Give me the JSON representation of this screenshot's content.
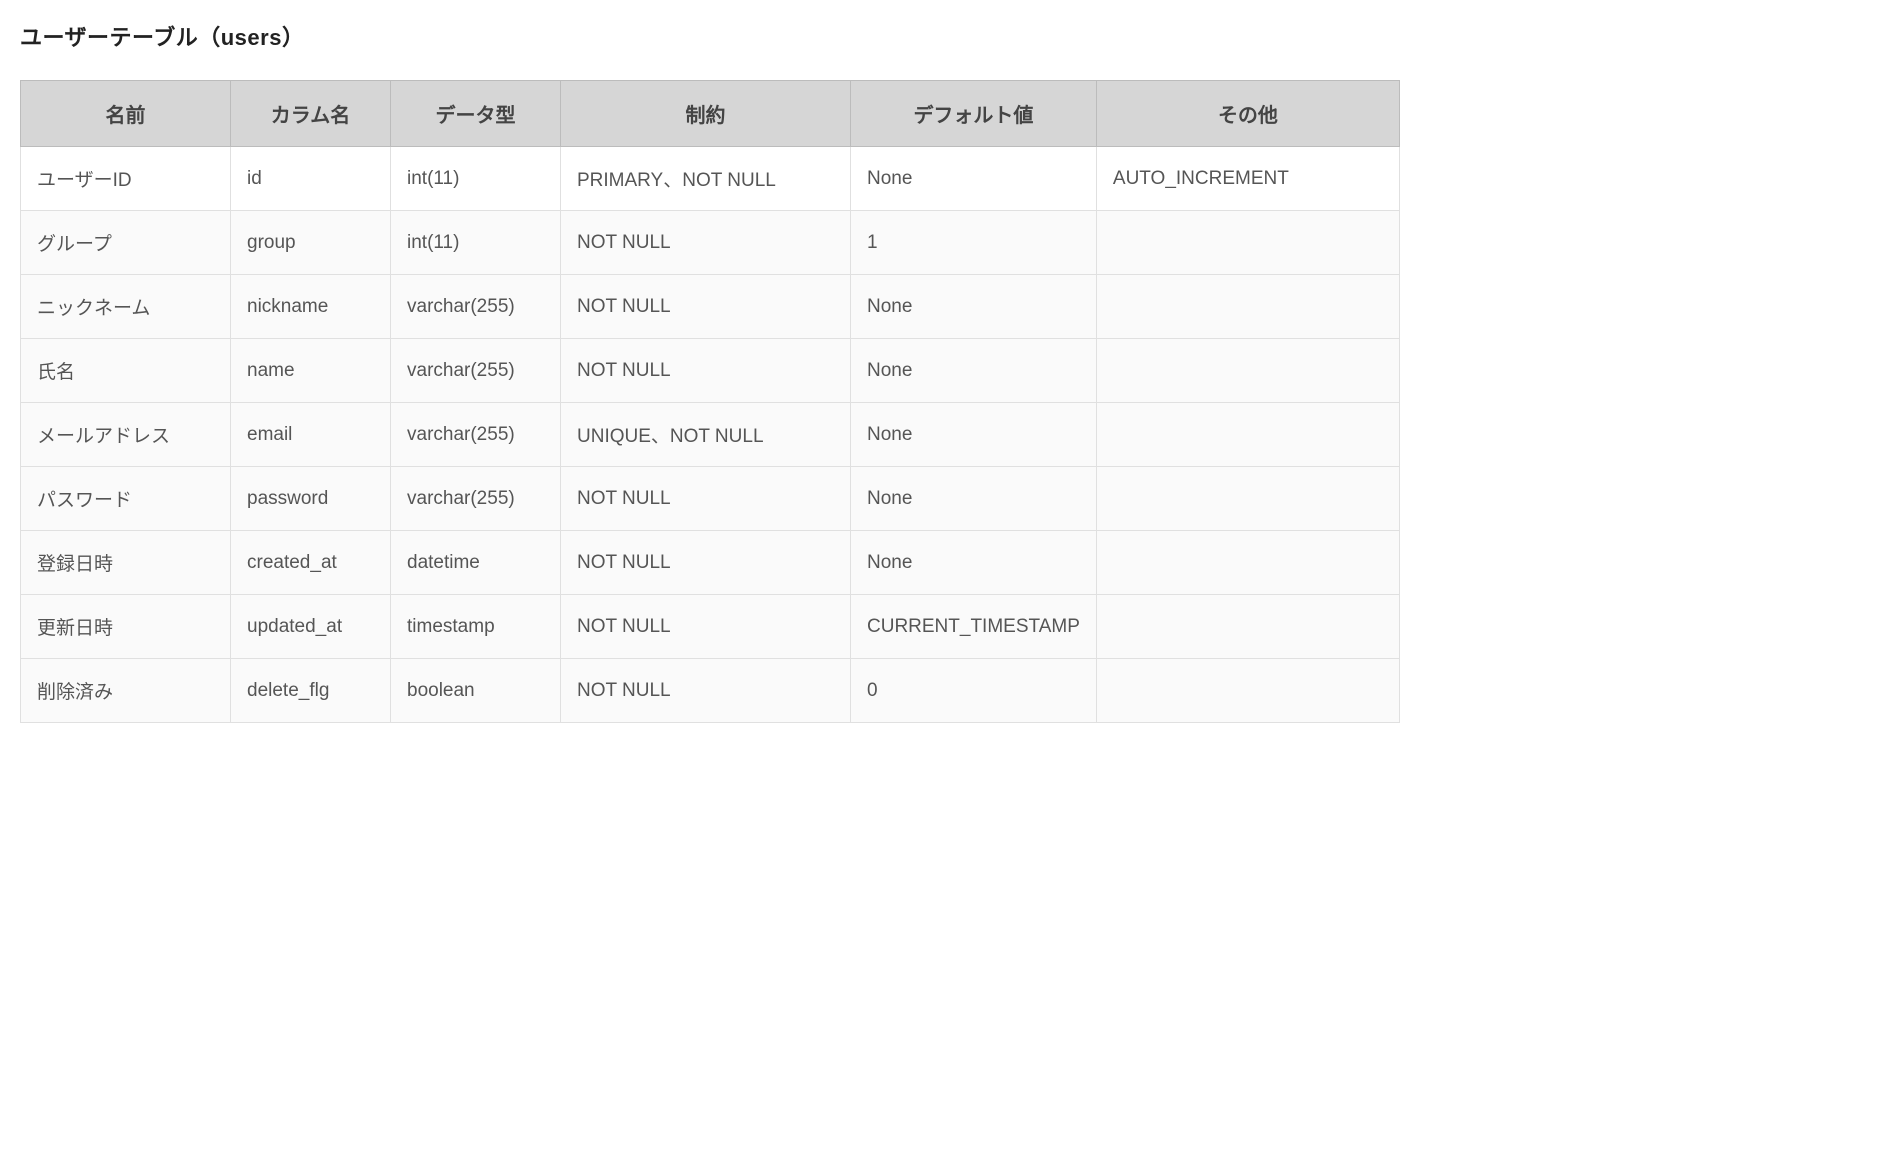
{
  "title": "ユーザーテーブル（users）",
  "headers": {
    "name": "名前",
    "column": "カラム名",
    "type": "データ型",
    "constraint": "制約",
    "default": "デフォルト値",
    "other": "その他"
  },
  "rows": [
    {
      "name": "ユーザーID",
      "column": "id",
      "type": "int(11)",
      "constraint": "PRIMARY、NOT NULL",
      "default": "None",
      "other": "AUTO_INCREMENT"
    },
    {
      "name": "グループ",
      "column": "group",
      "type": "int(11)",
      "constraint": "NOT NULL",
      "default": "1",
      "other": ""
    },
    {
      "name": "ニックネーム",
      "column": "nickname",
      "type": "varchar(255)",
      "constraint": "NOT NULL",
      "default": "None",
      "other": ""
    },
    {
      "name": "氏名",
      "column": "name",
      "type": "varchar(255)",
      "constraint": "NOT NULL",
      "default": "None",
      "other": ""
    },
    {
      "name": "メールアドレス",
      "column": "email",
      "type": "varchar(255)",
      "constraint": "UNIQUE、NOT NULL",
      "default": "None",
      "other": ""
    },
    {
      "name": "パスワード",
      "column": "password",
      "type": "varchar(255)",
      "constraint": "NOT NULL",
      "default": "None",
      "other": ""
    },
    {
      "name": "登録日時",
      "column": "created_at",
      "type": "datetime",
      "constraint": "NOT NULL",
      "default": "None",
      "other": ""
    },
    {
      "name": "更新日時",
      "column": "updated_at",
      "type": "timestamp",
      "constraint": "NOT NULL",
      "default": "CURRENT_TIMESTAMP",
      "other": ""
    },
    {
      "name": "削除済み",
      "column": "delete_flg",
      "type": "boolean",
      "constraint": "NOT NULL",
      "default": "0",
      "other": ""
    }
  ]
}
